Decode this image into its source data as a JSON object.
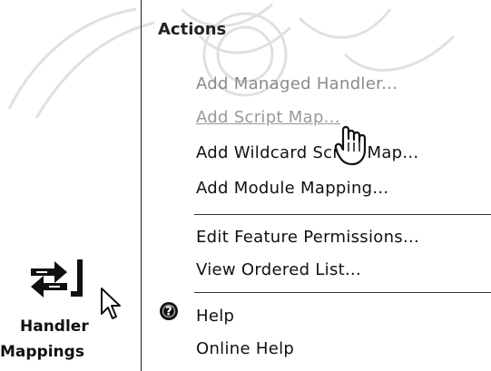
{
  "left": {
    "feature_name_line1": "Handler",
    "feature_name_line2": "Mappings"
  },
  "actions": {
    "title": "Actions",
    "items": [
      {
        "label": "Add Managed Handler...",
        "state": "disabled"
      },
      {
        "label": "Add Script Map...",
        "state": "hover"
      },
      {
        "label": "Add Wildcard Script Map...",
        "state": "normal"
      },
      {
        "label": "Add Module Mapping...",
        "state": "normal"
      },
      {
        "label": "Edit Feature Permissions...",
        "state": "normal"
      },
      {
        "label": "View Ordered List...",
        "state": "normal"
      },
      {
        "label": "Help",
        "state": "normal"
      },
      {
        "label": "Online Help",
        "state": "normal"
      }
    ]
  },
  "icons": {
    "feature": "handler-mappings-icon",
    "cursor": "arrow-cursor-icon",
    "hand": "hand-cursor-icon",
    "help": "help-icon"
  }
}
